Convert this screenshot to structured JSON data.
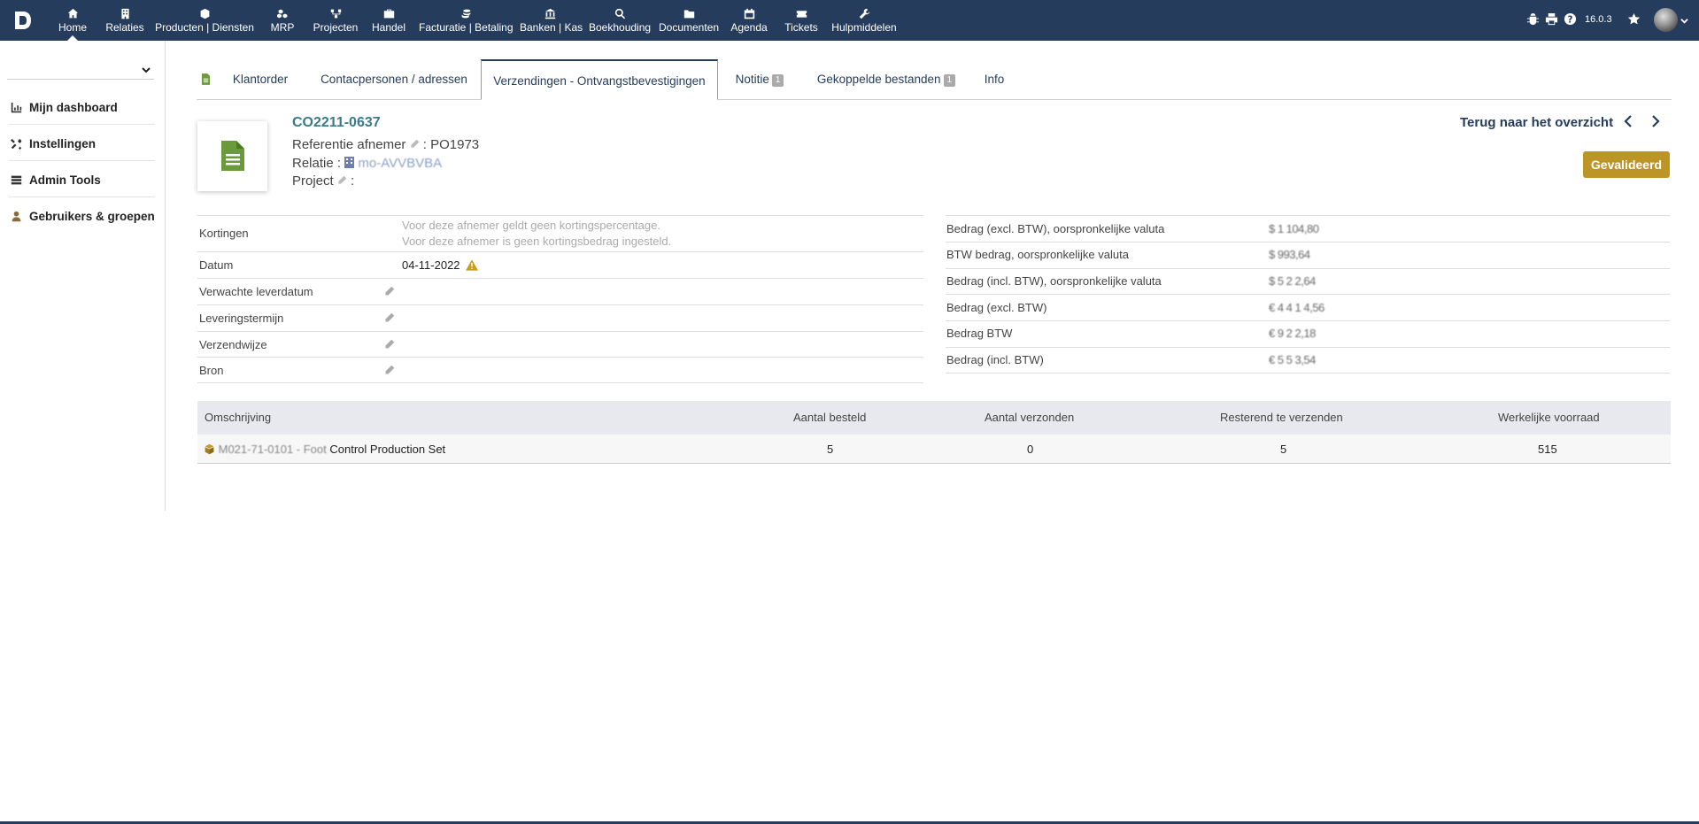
{
  "topnav": {
    "items": [
      {
        "label": "Home",
        "icon": "home-icon"
      },
      {
        "label": "Relaties",
        "icon": "building-icon"
      },
      {
        "label": "Producten | Diensten",
        "icon": "cube-icon"
      },
      {
        "label": "MRP",
        "icon": "cubes-icon"
      },
      {
        "label": "Projecten",
        "icon": "sitemap-icon"
      },
      {
        "label": "Handel",
        "icon": "briefcase-icon"
      },
      {
        "label": "Facturatie | Betaling",
        "icon": "coins-icon"
      },
      {
        "label": "Banken | Kas",
        "icon": "bank-icon"
      },
      {
        "label": "Boekhouding",
        "icon": "search-dollar-icon"
      },
      {
        "label": "Documenten",
        "icon": "folder-icon"
      },
      {
        "label": "Agenda",
        "icon": "calendar-icon"
      },
      {
        "label": "Tickets",
        "icon": "ticket-icon"
      },
      {
        "label": "Hulpmiddelen",
        "icon": "wrench-icon"
      }
    ],
    "version": "16.0.3"
  },
  "sidebar": {
    "items": [
      {
        "label": "Mijn dashboard",
        "icon": "chart-icon"
      },
      {
        "label": "Instellingen",
        "icon": "tools-icon"
      },
      {
        "label": "Admin Tools",
        "icon": "server-icon"
      },
      {
        "label": "Gebruikers & groepen",
        "icon": "user-icon"
      }
    ]
  },
  "tabs": [
    {
      "label": "Klantorder"
    },
    {
      "label": "Contacpersonen / adressen"
    },
    {
      "label": "Verzendingen - Ontvangstbevestigingen"
    },
    {
      "label": "Notitie",
      "badge": "1"
    },
    {
      "label": "Gekoppelde bestanden",
      "badge": "1"
    },
    {
      "label": "Info"
    }
  ],
  "header": {
    "ref": "CO2211-0637",
    "ref_afnemer_label": "Referentie afnemer",
    "ref_afnemer_value": ": PO1973",
    "relatie_label": "Relatie :",
    "relatie_value": "mo-AVVBVBA",
    "project_label": "Project",
    "project_value": ":",
    "back_link": "Terug naar het overzicht",
    "status": "Gevalideerd"
  },
  "info": {
    "kortingen_label": "Kortingen",
    "kortingen_line1": "Voor deze afnemer geldt geen kortingspercentage.",
    "kortingen_line2": "Voor deze afnemer is geen kortingsbedrag ingesteld.",
    "datum_label": "Datum",
    "datum_value": "04-11-2022",
    "leverdatum_label": "Verwachte leverdatum",
    "termijn_label": "Leveringstermijn",
    "verzendwijze_label": "Verzendwijze",
    "bron_label": "Bron"
  },
  "amounts": [
    {
      "label": "Bedrag (excl. BTW), oorspronkelijke valuta",
      "value": "$ 1 104,80"
    },
    {
      "label": "BTW bedrag, oorspronkelijke valuta",
      "value": "$ 993,64"
    },
    {
      "label": "Bedrag (incl. BTW), oorspronkelijke valuta",
      "value": "$ 5 2 2,64"
    },
    {
      "label": "Bedrag (excl. BTW)",
      "value": "€ 4 4 1 4,56"
    },
    {
      "label": "Bedrag BTW",
      "value": "€ 9 2 2,18"
    },
    {
      "label": "Bedrag (incl. BTW)",
      "value": "€ 5 5 3,54"
    }
  ],
  "products": {
    "headers": [
      "Omschrijving",
      "Aantal besteld",
      "Aantal verzonden",
      "Resterend te verzenden",
      "Werkelijke voorraad"
    ],
    "rows": [
      {
        "code": "M021-71-0101 - Foot",
        "name": "Control Production Set",
        "besteld": "5",
        "verzonden": "0",
        "resterend": "5",
        "voorraad": "515"
      }
    ]
  }
}
